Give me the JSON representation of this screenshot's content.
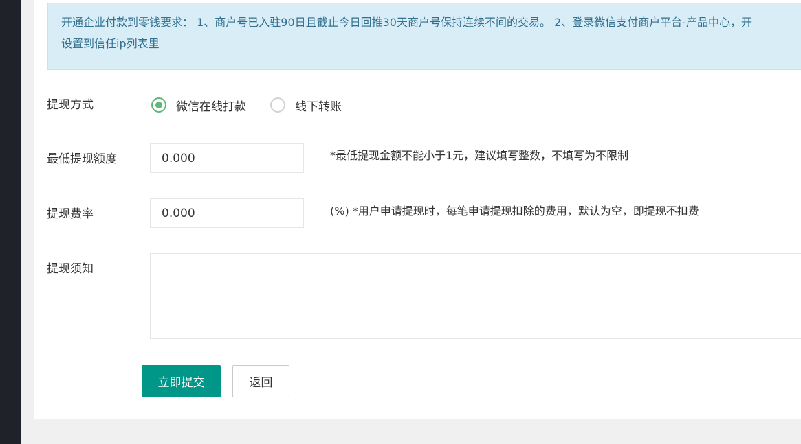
{
  "notice": {
    "line1": "开通企业付款到零钱要求： 1、商户号已入驻90日且截止今日回推30天商户号保持连续不间的交易。 2、登录微信支付商户平台-产品中心，开",
    "line2": "设置到信任ip列表里"
  },
  "form": {
    "method": {
      "label": "提现方式",
      "options": [
        {
          "label": "微信在线打款",
          "checked": true
        },
        {
          "label": "线下转账",
          "checked": false
        }
      ]
    },
    "min_amount": {
      "label": "最低提现额度",
      "value": "0.000",
      "hint": "*最低提现金额不能小于1元，建议填写整数，不填写为不限制"
    },
    "fee_rate": {
      "label": "提现费率",
      "value": "0.000",
      "hint": "(%) *用户申请提现时，每笔申请提现扣除的费用，默认为空，即提现不扣费"
    },
    "notes": {
      "label": "提现须知",
      "value": ""
    }
  },
  "buttons": {
    "submit": "立即提交",
    "back": "返回"
  },
  "colors": {
    "primary": "#009688",
    "radio_checked": "#5fb878",
    "notice_bg": "#d9edf7",
    "notice_text": "#31708f",
    "sidebar": "#20222a"
  }
}
